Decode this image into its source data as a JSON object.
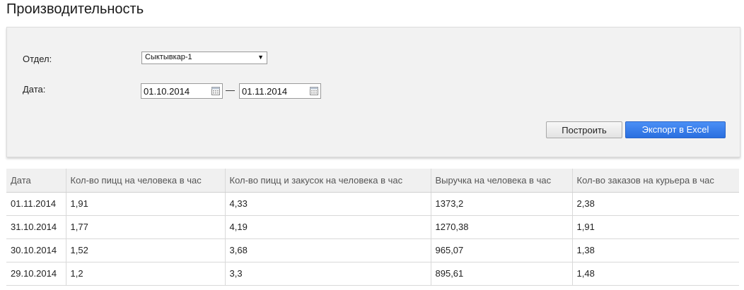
{
  "page": {
    "title": "Производительность"
  },
  "filters": {
    "department_label": "Отдел:",
    "department_value": "Сыктывкар-1",
    "date_label": "Дата:",
    "date_from": "01.10.2014",
    "date_separator": "—",
    "date_to": "01.11.2014",
    "build_button": "Построить",
    "export_button": "Экспорт в Excel"
  },
  "colors": {
    "export_button": "#2f74e6",
    "panel_background": "#f2f2f2"
  },
  "table": {
    "headers": [
      "Дата",
      "Кол-во пицц на человека в час",
      "Кол-во пицц и закусок на человека в час",
      "Выручка на человека в час",
      "Кол-во заказов на курьера в час"
    ],
    "rows": [
      [
        "01.11.2014",
        "1,91",
        "4,33",
        "1373,2",
        "2,38"
      ],
      [
        "31.10.2014",
        "1,77",
        "4,19",
        "1270,38",
        "1,91"
      ],
      [
        "30.10.2014",
        "1,52",
        "3,68",
        "965,07",
        "1,38"
      ],
      [
        "29.10.2014",
        "1,2",
        "3,3",
        "895,61",
        "1,48"
      ]
    ]
  }
}
